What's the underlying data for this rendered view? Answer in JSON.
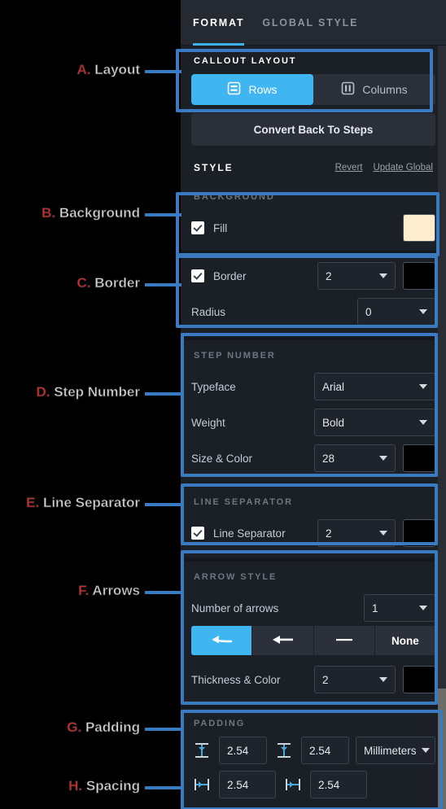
{
  "panel": {
    "tabs": [
      {
        "label": "FORMAT",
        "active": true
      },
      {
        "label": "GLOBAL STYLE",
        "active": false
      }
    ],
    "callout_layout": {
      "title": "CALLOUT LAYOUT",
      "options": [
        {
          "label": "Rows",
          "icon": "rows-icon",
          "selected": true
        },
        {
          "label": "Columns",
          "icon": "columns-icon",
          "selected": false
        }
      ],
      "convert_button": "Convert Back To Steps"
    },
    "style_header": {
      "title": "STYLE",
      "revert": "Revert",
      "update_global": "Update Global"
    },
    "background": {
      "title": "BACKGROUND",
      "fill_label": "Fill",
      "fill_checked": true,
      "fill_color": "#fdecce"
    },
    "border": {
      "border_label": "Border",
      "border_checked": true,
      "border_width": "2",
      "border_color": "#000000",
      "radius_label": "Radius",
      "radius_value": "0"
    },
    "step_number": {
      "title": "STEP NUMBER",
      "typeface_label": "Typeface",
      "typeface_value": "Arial",
      "weight_label": "Weight",
      "weight_value": "Bold",
      "size_color_label": "Size & Color",
      "size_value": "28",
      "color": "#000000"
    },
    "line_separator": {
      "title": "LINE SEPARATOR",
      "label": "Line Separator",
      "checked": true,
      "width": "2",
      "color": "#000000"
    },
    "arrow_style": {
      "title": "ARROW STYLE",
      "number_label": "Number of arrows",
      "number_value": "1",
      "styles": [
        {
          "icon": "arrow-curved-left-icon",
          "label": "",
          "selected": true
        },
        {
          "icon": "arrow-straight-left-icon",
          "label": "",
          "selected": false
        },
        {
          "icon": "line-icon",
          "label": "",
          "selected": false
        },
        {
          "icon": "none-icon",
          "label": "None",
          "selected": false
        }
      ],
      "thickness_label": "Thickness & Color",
      "thickness_value": "2",
      "color": "#000000"
    },
    "padding": {
      "title": "PADDING",
      "top_icon": "padding-top-icon",
      "top_value": "2.54",
      "bottom_icon": "padding-bottom-icon",
      "bottom_value": "2.54",
      "units": "Millimeters",
      "left_icon": "padding-left-icon",
      "left_value": "2.54",
      "right_icon": "padding-right-icon",
      "right_value": "2.54"
    }
  },
  "annotations": [
    {
      "id": "A",
      "letter": "A.",
      "text": "Layout"
    },
    {
      "id": "B",
      "letter": "B.",
      "text": "Background"
    },
    {
      "id": "C",
      "letter": "C.",
      "text": "Border"
    },
    {
      "id": "D",
      "letter": "D.",
      "text": "Step Number"
    },
    {
      "id": "E",
      "letter": "E.",
      "text": "Line Separator"
    },
    {
      "id": "F",
      "letter": "F.",
      "text": "Arrows"
    },
    {
      "id": "G",
      "letter": "G.",
      "text": "Padding"
    },
    {
      "id": "H",
      "letter": "H.",
      "text": "Spacing"
    }
  ],
  "colors": {
    "accent": "#3fb6f2",
    "annotation_blue": "#3a7ac0",
    "annotation_red": "#d42a2a",
    "panel_bg": "#1b1f26"
  }
}
